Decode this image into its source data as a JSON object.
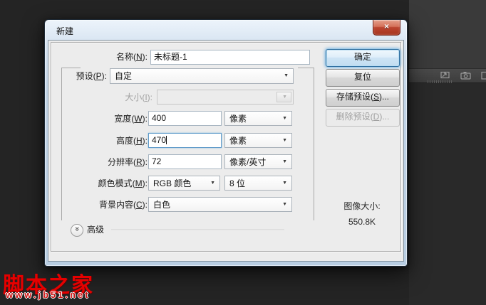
{
  "window": {
    "title": "新建",
    "close_glyph": "×"
  },
  "form": {
    "name": {
      "label_pre": "名称(",
      "mnemonic": "N",
      "label_post": "):",
      "value": "未标题-1"
    },
    "preset": {
      "label_pre": "预设(",
      "mnemonic": "P",
      "label_post": "):",
      "value": "自定"
    },
    "size": {
      "label_pre": "大小(",
      "mnemonic": "I",
      "label_post": "):",
      "value": ""
    },
    "width": {
      "label_pre": "宽度(",
      "mnemonic": "W",
      "label_post": "):",
      "value": "400",
      "unit": "像素"
    },
    "height": {
      "label_pre": "高度(",
      "mnemonic": "H",
      "label_post": "):",
      "value": "470",
      "unit": "像素"
    },
    "resolution": {
      "label_pre": "分辨率(",
      "mnemonic": "R",
      "label_post": "):",
      "value": "72",
      "unit": "像素/英寸"
    },
    "color_mode": {
      "label_pre": "颜色模式(",
      "mnemonic": "M",
      "label_post": "):",
      "value": "RGB 颜色",
      "bit_depth": "8 位"
    },
    "background_contents": {
      "label_pre": "背景内容(",
      "mnemonic": "C",
      "label_post": "):",
      "value": "白色"
    },
    "advanced": {
      "label": "高级"
    }
  },
  "buttons": {
    "ok": "确定",
    "reset": "复位",
    "save_preset": {
      "pre": "存储预设(",
      "mnemonic": "S",
      "post": ")..."
    },
    "delete_preset": {
      "pre": "删除预设(",
      "mnemonic": "D",
      "post": ")..."
    }
  },
  "info": {
    "image_size_label": "图像大小:",
    "image_size_value": "550.8K"
  },
  "watermark": {
    "site_name": "脚本之家",
    "site_url": "www.jb51.net"
  },
  "colors": {
    "dialog_frame": "#c2d4e7",
    "dialog_bg": "#ececec",
    "close_button_red": "#bc4530",
    "focus_glow_blue": "#69afe1",
    "canvas_dark": "#242424",
    "watermark_red": "#e60000"
  }
}
